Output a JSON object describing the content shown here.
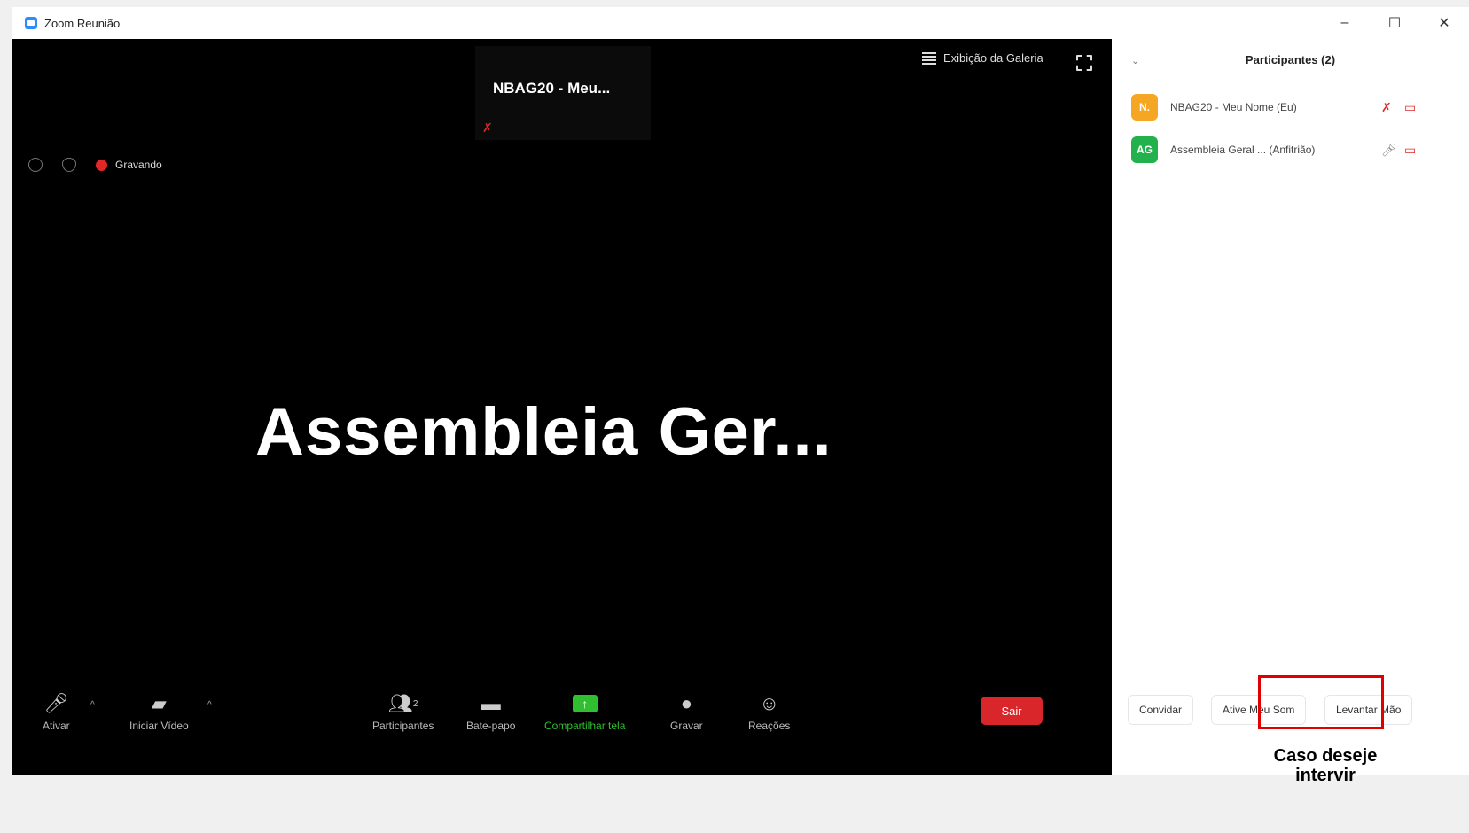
{
  "window": {
    "title": "Zoom Reunião",
    "controls": [
      "–",
      "☐",
      "✕"
    ]
  },
  "video": {
    "top_tile_name": "NBAG20 - Meu...",
    "gallery_view_label": "Exibição da Galeria",
    "recording_label": "Gravando",
    "speaker_name": "Assembleia  Ger..."
  },
  "toolbar": {
    "mute_label": "Ativar",
    "video_label": "Iniciar Vídeo",
    "participants_label": "Participantes",
    "participants_count": "2",
    "chat_label": "Bate-papo",
    "share_label": "Compartilhar tela",
    "record_label": "Gravar",
    "reactions_label": "Reações",
    "leave_label": "Sair"
  },
  "participants_panel": {
    "title": "Participantes (2)",
    "participants": [
      {
        "initials": "N.",
        "name": "NBAG20 - Meu Nome (Eu)",
        "avatar_color": "#f5a623"
      },
      {
        "initials": "AG",
        "name": "Assembleia Geral ... (Anfitrião)",
        "avatar_color": "#22b14c"
      }
    ],
    "invite_label": "Convidar",
    "unmute_me_label": "Ative Meu Som",
    "raise_hand_label": "Levantar Mão"
  },
  "annotation": {
    "highlight_color": "#e00000",
    "note_line1": "Caso deseje",
    "note_line2": "intervir"
  }
}
